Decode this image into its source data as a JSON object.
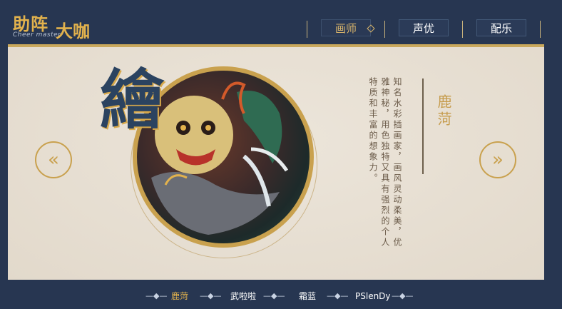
{
  "brand": {
    "title_part1": "助阵",
    "title_part2": "大咖",
    "subtitle": "Cheer master"
  },
  "nav": {
    "tabs": [
      {
        "label": "画师",
        "active": true
      },
      {
        "label": "声优",
        "active": false
      },
      {
        "label": "配乐",
        "active": false
      }
    ]
  },
  "feature": {
    "big_char": "繪",
    "artist_name": "鹿菏",
    "description": "知名水彩插画家，画风灵动柔美，优雅神秘，用色独特又具有强烈的个人特质和丰富的想象力。"
  },
  "carousel": {
    "prev_icon": "chevron-left-icon",
    "next_icon": "chevron-right-icon"
  },
  "footer": {
    "items": [
      {
        "label": "鹿菏",
        "active": true
      },
      {
        "label": "武啦啦",
        "active": false
      },
      {
        "label": "霜蓝",
        "active": false
      },
      {
        "label": "PSlenDy",
        "active": false
      }
    ],
    "separator": "—◆—"
  },
  "colors": {
    "background": "#273651",
    "accent_gold": "#e2b24d",
    "panel": "#e5ddd0"
  }
}
